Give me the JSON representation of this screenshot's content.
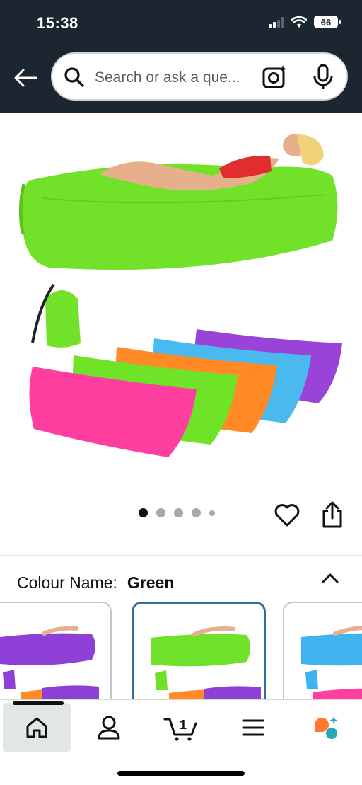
{
  "status_bar": {
    "time": "15:38",
    "battery": "66"
  },
  "search": {
    "placeholder": "Search or ask a que..."
  },
  "gallery": {
    "image_count": 5,
    "active_index": 0
  },
  "colour": {
    "label": "Colour Name:",
    "value": "Green",
    "swatches": [
      {
        "name": "purple",
        "color": "#8e3fd6"
      },
      {
        "name": "green",
        "color": "#6fe12a"
      },
      {
        "name": "blue",
        "color": "#3fb3ee"
      }
    ],
    "selected": "green"
  },
  "bottom_nav": {
    "cart_count": "1",
    "items": [
      "home",
      "account",
      "cart",
      "menu",
      "ai"
    ]
  },
  "colors": {
    "header_bg": "#1b2631",
    "selected_border": "#2f6ea5"
  }
}
